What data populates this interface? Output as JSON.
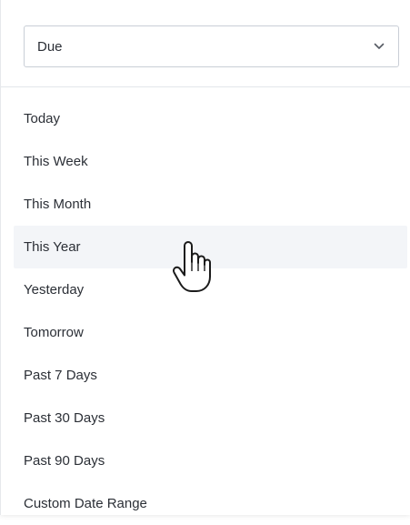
{
  "filter": {
    "selected_value": "Due",
    "chevron_icon": "chevron-down-icon"
  },
  "options": [
    {
      "label": "Today"
    },
    {
      "label": "This Week"
    },
    {
      "label": "This Month"
    },
    {
      "label": "This Year",
      "hovered": true
    },
    {
      "label": "Yesterday"
    },
    {
      "label": "Tomorrow"
    },
    {
      "label": "Past 7 Days"
    },
    {
      "label": "Past 30 Days"
    },
    {
      "label": "Past 90 Days"
    },
    {
      "label": "Custom Date Range"
    }
  ],
  "cursor_icon": "hand-pointer-icon",
  "colors": {
    "hover_background": "#f3f5f8",
    "text": "#2b2f36",
    "border": "#c9ced6"
  }
}
